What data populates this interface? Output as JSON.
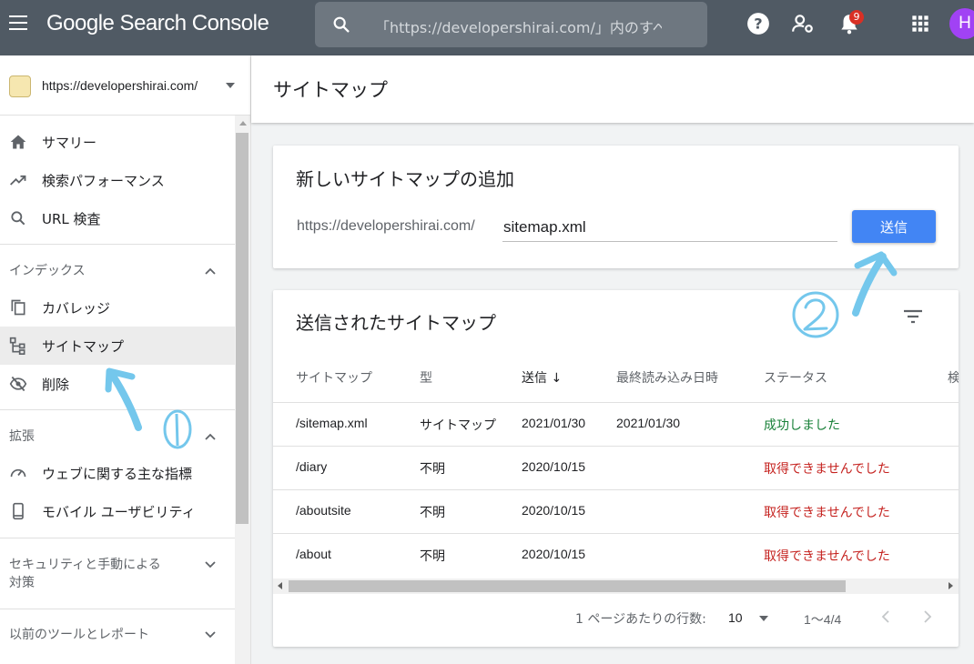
{
  "header": {
    "app_title": "Google Search Console",
    "search_placeholder": "「https://developershirai.com/」内のすべて",
    "notification_count": "9",
    "avatar_initial": "H"
  },
  "sidebar": {
    "property": "https://developershirai.com/",
    "nav_top": [
      {
        "label": "サマリー",
        "icon": "home-icon"
      },
      {
        "label": "検索パフォーマンス",
        "icon": "trending-up-icon"
      },
      {
        "label": "URL 検査",
        "icon": "search-icon"
      }
    ],
    "sections": {
      "index": "インデックス",
      "enhancements": "拡張",
      "security": "セキュリティと手動による対策",
      "legacy": "以前のツールとレポート"
    },
    "index_items": [
      {
        "label": "カバレッジ",
        "icon": "copy-icon"
      },
      {
        "label": "サイトマップ",
        "icon": "sitemap-icon",
        "active": true
      },
      {
        "label": "削除",
        "icon": "visibility-off-icon"
      }
    ],
    "enh_items": [
      {
        "label": "ウェブに関する主な指標",
        "icon": "speed-icon"
      },
      {
        "label": "モバイル ユーザビリティ",
        "icon": "smartphone-icon"
      }
    ]
  },
  "main": {
    "page_title": "サイトマップ",
    "add_card": {
      "title": "新しいサイトマップの追加",
      "prefix": "https://developershirai.com/",
      "input_value": "sitemap.xml",
      "submit_label": "送信"
    },
    "list_card": {
      "title": "送信されたサイトマップ",
      "columns": [
        "サイトマップ",
        "型",
        "送信",
        "最終読み込み日時",
        "ステータス",
        "検"
      ],
      "sort_indicator": "↓",
      "rows": [
        {
          "sitemap": "/sitemap.xml",
          "type": "サイトマップ",
          "submitted": "2021/01/30",
          "last_read": "2021/01/30",
          "status": "成功しました",
          "status_kind": "ok"
        },
        {
          "sitemap": "/diary",
          "type": "不明",
          "submitted": "2020/10/15",
          "last_read": "",
          "status": "取得できませんでした",
          "status_kind": "err"
        },
        {
          "sitemap": "/aboutsite",
          "type": "不明",
          "submitted": "2020/10/15",
          "last_read": "",
          "status": "取得できませんでした",
          "status_kind": "err"
        },
        {
          "sitemap": "/about",
          "type": "不明",
          "submitted": "2020/10/15",
          "last_read": "",
          "status": "取得できませんでした",
          "status_kind": "err"
        }
      ],
      "pagination": {
        "rows_per_page_label": "1 ページあたりの行数:",
        "rows_per_page": "10",
        "range": "1〜4/4"
      }
    }
  },
  "colors": {
    "header_bg": "#505a64",
    "primary": "#4285f4",
    "success": "#188038",
    "error": "#c5221f",
    "annotation": "#74c7ec"
  }
}
